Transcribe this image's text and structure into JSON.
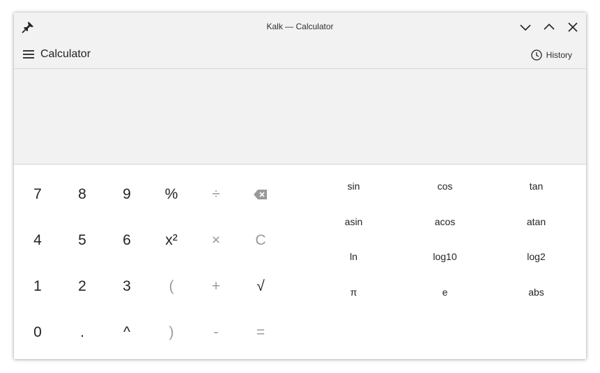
{
  "window": {
    "title": "Kalk — Calculator"
  },
  "toolbar": {
    "page_title": "Calculator",
    "history_label": "History"
  },
  "display": {
    "expression": "",
    "result": ""
  },
  "numpad": [
    {
      "label": "7",
      "kind": "digit"
    },
    {
      "label": "8",
      "kind": "digit"
    },
    {
      "label": "9",
      "kind": "digit"
    },
    {
      "label": "%",
      "kind": "digit"
    },
    {
      "label": "÷",
      "kind": "op"
    },
    {
      "label": "",
      "kind": "backspace"
    },
    {
      "label": "4",
      "kind": "digit"
    },
    {
      "label": "5",
      "kind": "digit"
    },
    {
      "label": "6",
      "kind": "digit"
    },
    {
      "label": "x²",
      "kind": "digit"
    },
    {
      "label": "×",
      "kind": "op"
    },
    {
      "label": "C",
      "kind": "op"
    },
    {
      "label": "1",
      "kind": "digit"
    },
    {
      "label": "2",
      "kind": "digit"
    },
    {
      "label": "3",
      "kind": "digit"
    },
    {
      "label": "(",
      "kind": "op"
    },
    {
      "label": "+",
      "kind": "op"
    },
    {
      "label": "√",
      "kind": "digit"
    },
    {
      "label": "0",
      "kind": "digit"
    },
    {
      "label": ".",
      "kind": "digit"
    },
    {
      "label": "^",
      "kind": "digit"
    },
    {
      "label": ")",
      "kind": "op"
    },
    {
      "label": "-",
      "kind": "op"
    },
    {
      "label": "=",
      "kind": "op"
    }
  ],
  "functions": [
    "sin",
    "cos",
    "tan",
    "asin",
    "acos",
    "atan",
    "ln",
    "log10",
    "log2",
    "π",
    "e",
    "abs"
  ],
  "icons": {
    "pin": "pin-icon",
    "minimize": "chevron-down-icon",
    "maximize": "chevron-up-icon",
    "close": "close-icon",
    "menu": "hamburger-icon",
    "history": "clock-icon",
    "backspace": "backspace-icon"
  },
  "colors": {
    "titlebar_bg": "#f2f2f2",
    "display_bg": "#f2f2f2",
    "text": "#232323",
    "operator_text": "#9a9a9a"
  }
}
